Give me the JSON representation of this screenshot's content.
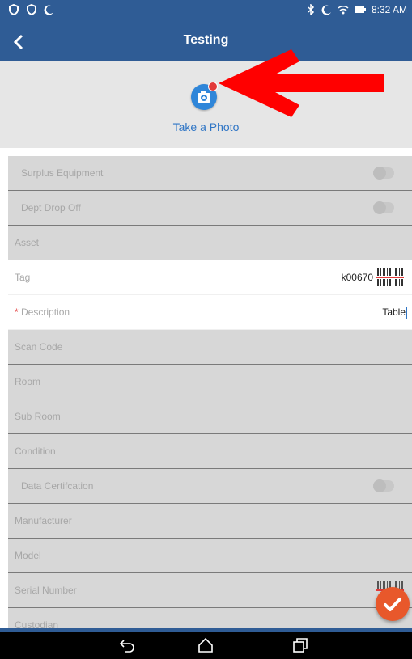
{
  "status_bar": {
    "time": "8:32 AM",
    "left_icons": [
      "shield-icon",
      "shield-icon",
      "moon-icon"
    ],
    "right_icons": [
      "bluetooth-icon",
      "moon-icon",
      "wifi-icon",
      "battery-icon"
    ]
  },
  "app_bar": {
    "title": "Testing",
    "back_icon": "chevron-left-icon"
  },
  "photo": {
    "label": "Take a Photo",
    "icon": "camera-icon"
  },
  "form": {
    "rows": [
      {
        "label": "Surplus Equipment",
        "type": "toggle",
        "enabled": false
      },
      {
        "label": "Dept Drop Off",
        "type": "toggle",
        "enabled": false
      },
      {
        "label": "Asset",
        "type": "text",
        "enabled": false
      },
      {
        "label": "Tag",
        "type": "text",
        "enabled": true,
        "value": "k00670"
      },
      {
        "label": "Description",
        "required_mark": "*",
        "type": "text",
        "enabled": true,
        "value": "Table"
      },
      {
        "label": "Scan Code",
        "type": "text",
        "enabled": false
      },
      {
        "label": "Room",
        "type": "text",
        "enabled": false
      },
      {
        "label": "Sub Room",
        "type": "text",
        "enabled": false
      },
      {
        "label": "Condition",
        "type": "text",
        "enabled": false
      },
      {
        "label": "Data Certifcation",
        "type": "toggle",
        "enabled": false
      },
      {
        "label": "Manufacturer",
        "type": "text",
        "enabled": false
      },
      {
        "label": "Model",
        "type": "text",
        "enabled": false
      },
      {
        "label": "Serial Number",
        "type": "text",
        "enabled": false
      },
      {
        "label": "Custodian",
        "type": "text",
        "enabled": false
      }
    ]
  },
  "fab": {
    "icon": "checkmark-icon"
  },
  "nav_bar": {
    "icons": [
      "back-nav-icon",
      "home-nav-icon",
      "recents-nav-icon"
    ]
  },
  "colors": {
    "primary": "#2f5c95",
    "accent": "#2f86d9",
    "fab": "#e8582b",
    "arrow": "#ff0000"
  }
}
